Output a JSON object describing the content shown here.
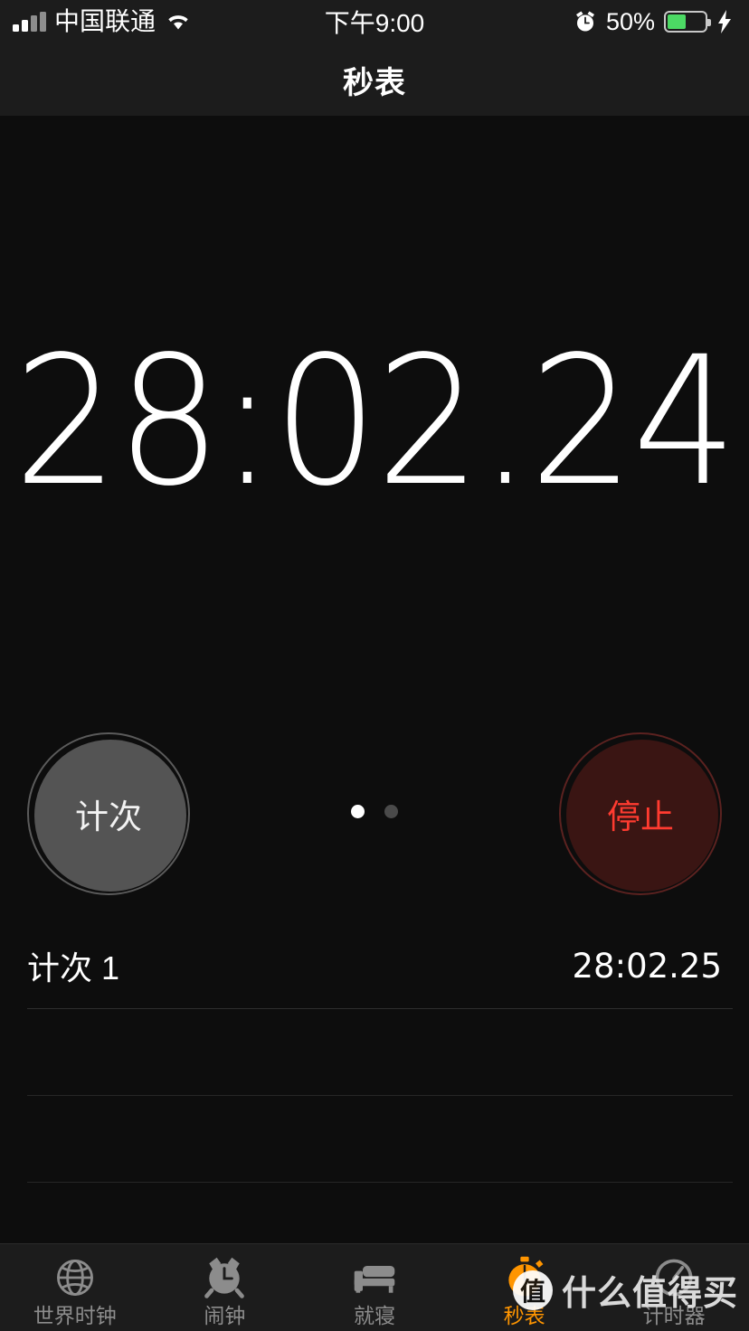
{
  "status_bar": {
    "carrier": "中国联通",
    "signal_bars_total": 4,
    "signal_bars_active": 2,
    "wifi_icon": "wifi-icon",
    "time": "下午9:00",
    "alarm_icon": "alarm-clock-icon",
    "battery_percent": "50%",
    "battery_level": 50,
    "battery_color": "#4cd964",
    "charging_icon": "lightning-bolt-icon"
  },
  "nav": {
    "title": "秒表"
  },
  "stopwatch": {
    "elapsed": "28:02.24"
  },
  "controls": {
    "lap_label": "计次",
    "stop_label": "停止",
    "pages": [
      {
        "active": true
      },
      {
        "active": false
      }
    ]
  },
  "laps": {
    "rows": [
      {
        "name": "计次 1",
        "time": "28:02.25"
      },
      {
        "name": "",
        "time": ""
      },
      {
        "name": "",
        "time": ""
      },
      {
        "name": "",
        "time": ""
      }
    ]
  },
  "tab_bar": {
    "items": [
      {
        "label": "世界时钟",
        "icon": "globe-icon",
        "active": false
      },
      {
        "label": "闹钟",
        "icon": "alarm-clock-icon",
        "active": false
      },
      {
        "label": "就寝",
        "icon": "bed-icon",
        "active": false
      },
      {
        "label": "秒表",
        "icon": "stopwatch-icon",
        "active": true
      },
      {
        "label": "计时器",
        "icon": "timer-icon",
        "active": false
      }
    ],
    "active_color": "#ff9500",
    "inactive_color": "#8c8c8c"
  },
  "watermark": {
    "badge": "值",
    "text": "什么值得买"
  },
  "colors": {
    "background": "#0d0d0d",
    "chrome": "#1c1c1c",
    "accent_orange": "#ff9500",
    "stop_red": "#ff3b30",
    "lap_gray": "#545454"
  }
}
